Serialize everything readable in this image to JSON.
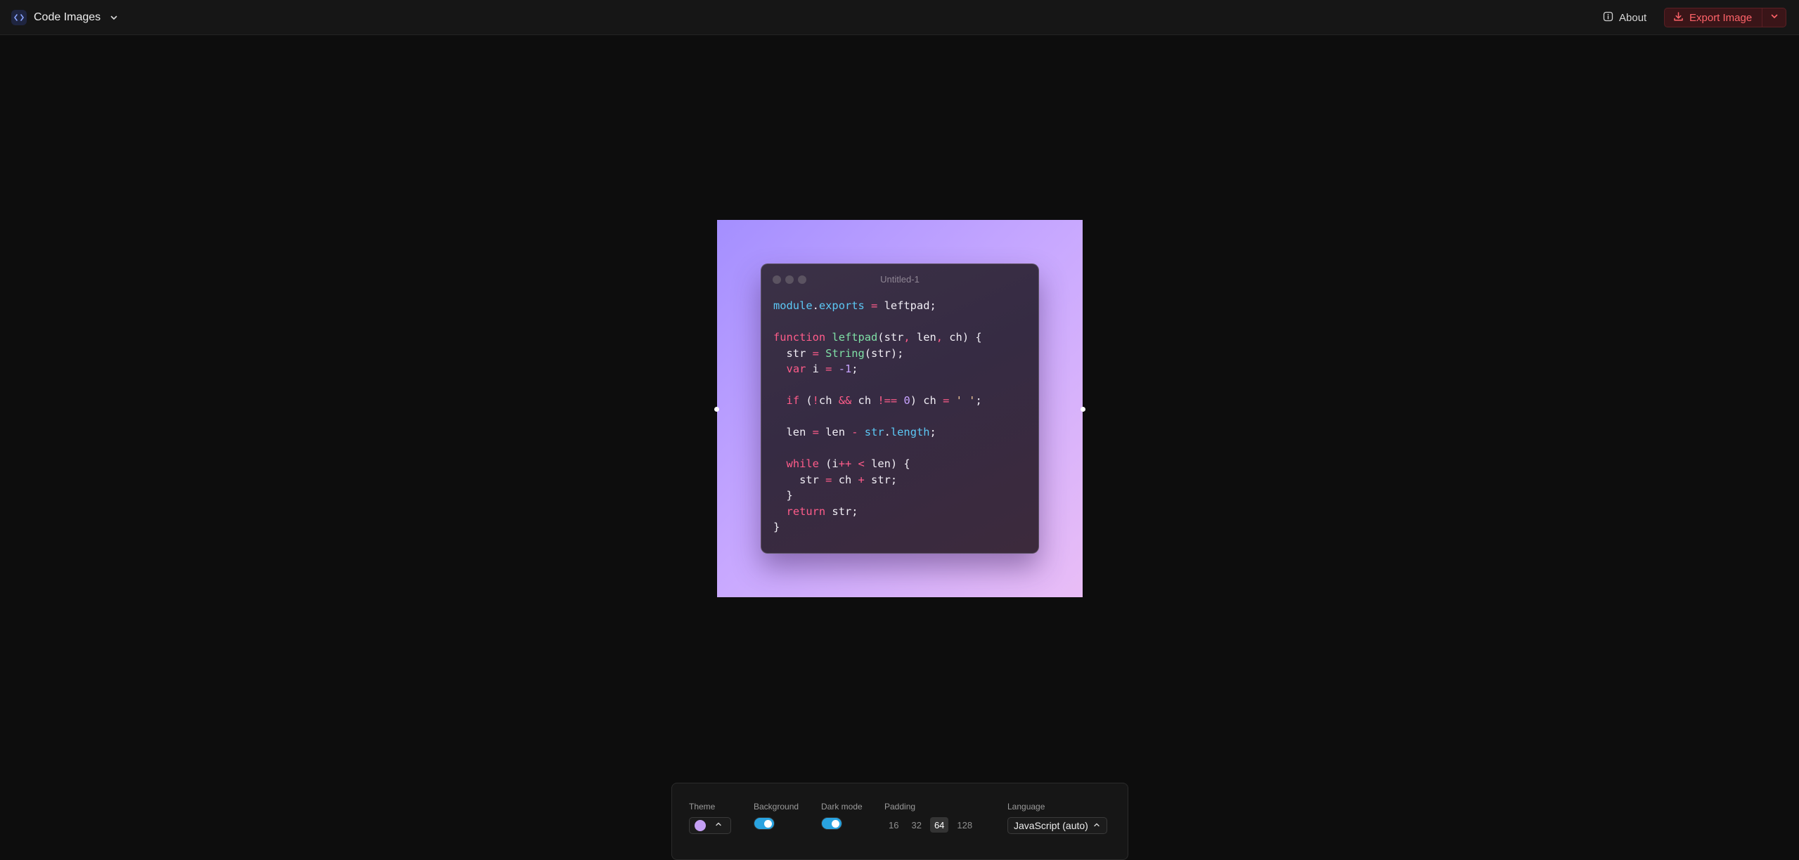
{
  "header": {
    "app_title": "Code Images",
    "about_label": "About",
    "export_label": "Export Image"
  },
  "editor": {
    "window_title": "Untitled-1",
    "code_lines": [
      [
        {
          "t": "module",
          "c": "#5cc8f5"
        },
        {
          "t": ".",
          "c": "#f1eef5"
        },
        {
          "t": "exports",
          "c": "#5cc8f5"
        },
        {
          "t": " ",
          "c": "#f1eef5"
        },
        {
          "t": "=",
          "c": "#ff5c8a"
        },
        {
          "t": " leftpad;",
          "c": "#f1eef5"
        }
      ],
      [],
      [
        {
          "t": "function",
          "c": "#ff5c8a"
        },
        {
          "t": " ",
          "c": "#f1eef5"
        },
        {
          "t": "leftpad",
          "c": "#7fe0a6"
        },
        {
          "t": "(str",
          "c": "#f1eef5"
        },
        {
          "t": ",",
          "c": "#ff5c8a"
        },
        {
          "t": " len",
          "c": "#f1eef5"
        },
        {
          "t": ",",
          "c": "#ff5c8a"
        },
        {
          "t": " ch) {",
          "c": "#f1eef5"
        }
      ],
      [
        {
          "t": "  str ",
          "c": "#f1eef5"
        },
        {
          "t": "=",
          "c": "#ff5c8a"
        },
        {
          "t": " ",
          "c": "#f1eef5"
        },
        {
          "t": "String",
          "c": "#7fe0a6"
        },
        {
          "t": "(str);",
          "c": "#f1eef5"
        }
      ],
      [
        {
          "t": "  ",
          "c": "#f1eef5"
        },
        {
          "t": "var",
          "c": "#ff5c8a"
        },
        {
          "t": " i ",
          "c": "#f1eef5"
        },
        {
          "t": "=",
          "c": "#ff5c8a"
        },
        {
          "t": " ",
          "c": "#f1eef5"
        },
        {
          "t": "-1",
          "c": "#c7a3ff"
        },
        {
          "t": ";",
          "c": "#f1eef5"
        }
      ],
      [],
      [
        {
          "t": "  ",
          "c": "#f1eef5"
        },
        {
          "t": "if",
          "c": "#ff5c8a"
        },
        {
          "t": " (",
          "c": "#f1eef5"
        },
        {
          "t": "!",
          "c": "#ff5c8a"
        },
        {
          "t": "ch ",
          "c": "#f1eef5"
        },
        {
          "t": "&&",
          "c": "#ff5c8a"
        },
        {
          "t": " ch ",
          "c": "#f1eef5"
        },
        {
          "t": "!==",
          "c": "#ff5c8a"
        },
        {
          "t": " ",
          "c": "#f1eef5"
        },
        {
          "t": "0",
          "c": "#c7a3ff"
        },
        {
          "t": ") ch ",
          "c": "#f1eef5"
        },
        {
          "t": "=",
          "c": "#ff5c8a"
        },
        {
          "t": " ",
          "c": "#f1eef5"
        },
        {
          "t": "' '",
          "c": "#f3c99b"
        },
        {
          "t": ";",
          "c": "#f1eef5"
        }
      ],
      [],
      [
        {
          "t": "  len ",
          "c": "#f1eef5"
        },
        {
          "t": "=",
          "c": "#ff5c8a"
        },
        {
          "t": " len ",
          "c": "#f1eef5"
        },
        {
          "t": "-",
          "c": "#ff5c8a"
        },
        {
          "t": " ",
          "c": "#f1eef5"
        },
        {
          "t": "str",
          "c": "#5cc8f5"
        },
        {
          "t": ".",
          "c": "#f1eef5"
        },
        {
          "t": "length",
          "c": "#5cc8f5"
        },
        {
          "t": ";",
          "c": "#f1eef5"
        }
      ],
      [],
      [
        {
          "t": "  ",
          "c": "#f1eef5"
        },
        {
          "t": "while",
          "c": "#ff5c8a"
        },
        {
          "t": " (i",
          "c": "#f1eef5"
        },
        {
          "t": "++",
          "c": "#ff5c8a"
        },
        {
          "t": " ",
          "c": "#f1eef5"
        },
        {
          "t": "<",
          "c": "#ff5c8a"
        },
        {
          "t": " len) {",
          "c": "#f1eef5"
        }
      ],
      [
        {
          "t": "    str ",
          "c": "#f1eef5"
        },
        {
          "t": "=",
          "c": "#ff5c8a"
        },
        {
          "t": " ch ",
          "c": "#f1eef5"
        },
        {
          "t": "+",
          "c": "#ff5c8a"
        },
        {
          "t": " str;",
          "c": "#f1eef5"
        }
      ],
      [
        {
          "t": "  }",
          "c": "#f1eef5"
        }
      ],
      [
        {
          "t": "  ",
          "c": "#f1eef5"
        },
        {
          "t": "return",
          "c": "#ff5c8a"
        },
        {
          "t": " str;",
          "c": "#f1eef5"
        }
      ],
      [
        {
          "t": "}",
          "c": "#f1eef5"
        }
      ]
    ]
  },
  "toolbar": {
    "theme_label": "Theme",
    "theme_swatch_color": "#c5a0f5",
    "background_label": "Background",
    "background_enabled": true,
    "dark_mode_label": "Dark mode",
    "dark_mode_enabled": true,
    "padding_label": "Padding",
    "padding_options": [
      "16",
      "32",
      "64",
      "128"
    ],
    "padding_selected": "64",
    "language_label": "Language",
    "language_value": "JavaScript (auto)"
  },
  "colors": {
    "accent_switch": "#29a3e0",
    "export_text": "#ff6369",
    "gradient_start": "#a48fff",
    "gradient_end": "#e9bdf6"
  },
  "icons": {
    "brand": "code-brackets-icon",
    "about": "info-icon",
    "export": "download-icon",
    "dropdown": "chevron-down-icon",
    "select": "chevron-up-icon"
  }
}
